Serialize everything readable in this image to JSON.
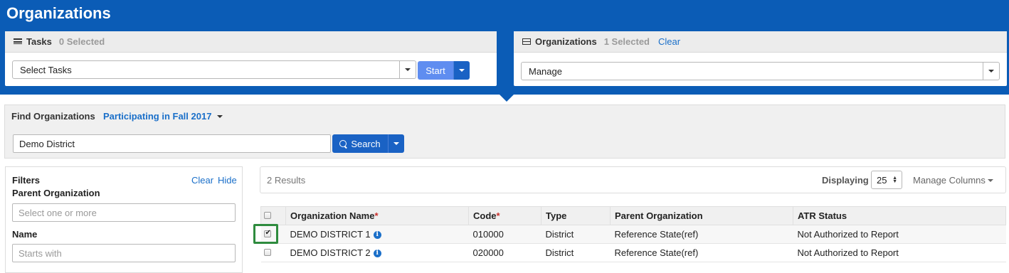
{
  "page_title": "Organizations",
  "tasks_panel": {
    "title": "Tasks",
    "selected_count": "0 Selected",
    "select_value": "Select Tasks",
    "start_label": "Start"
  },
  "orgs_panel": {
    "title": "Organizations",
    "selected_count": "1 Selected",
    "clear_label": "Clear",
    "select_value": "Manage"
  },
  "find": {
    "title": "Find Organizations",
    "filter_link": "Participating in Fall 2017",
    "search_value": "Demo District",
    "search_label": "Search"
  },
  "filters": {
    "title": "Filters",
    "clear_label": "Clear",
    "hide_label": "Hide",
    "parent_org_label": "Parent Organization",
    "parent_org_placeholder": "Select one or more",
    "name_label": "Name",
    "name_placeholder": "Starts with"
  },
  "results": {
    "count_text": "2 Results",
    "displaying_label": "Displaying",
    "page_size": "25",
    "manage_columns_label": "Manage Columns"
  },
  "table": {
    "headers": {
      "name": "Organization Name",
      "code": "Code",
      "type": "Type",
      "parent": "Parent Organization",
      "atr": "ATR Status",
      "required_mark": "*"
    },
    "rows": [
      {
        "name": "DEMO DISTRICT 1",
        "code": "010000",
        "type": "District",
        "parent": "Reference State(ref)",
        "atr": "Not Authorized to Report",
        "checked": true
      },
      {
        "name": "DEMO DISTRICT 2",
        "code": "020000",
        "type": "District",
        "parent": "Reference State(ref)",
        "atr": "Not Authorized to Report",
        "checked": false
      }
    ]
  },
  "colors": {
    "banner": "#0b5cb6",
    "primary_button": "#1a62c4",
    "start_button": "#5f8df0",
    "link": "#1a6fc9",
    "highlight_border": "#2e8b3e"
  },
  "icons": [
    "list-icon",
    "search-icon",
    "chevron-down-icon",
    "info-icon",
    "spinner-arrows-icon"
  ]
}
